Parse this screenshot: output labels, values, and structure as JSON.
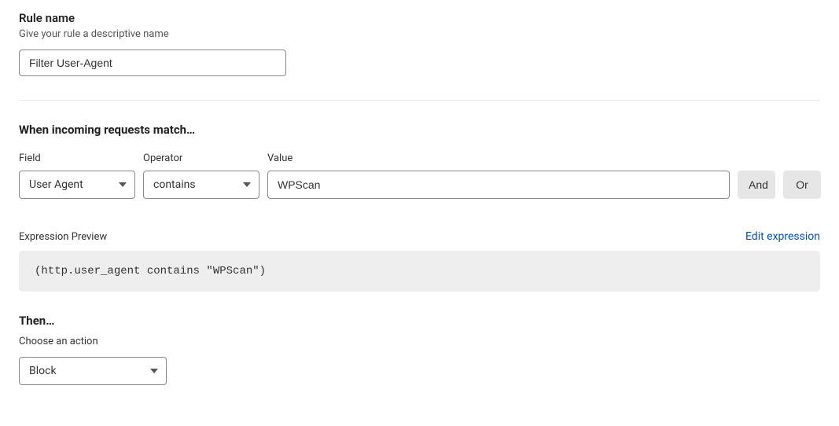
{
  "ruleName": {
    "title": "Rule name",
    "subtitle": "Give your rule a descriptive name",
    "value": "Filter User-Agent"
  },
  "match": {
    "heading": "When incoming requests match…",
    "labels": {
      "field": "Field",
      "operator": "Operator",
      "value": "Value"
    },
    "field": "User Agent",
    "operator": "contains",
    "value": "WPScan",
    "andBtn": "And",
    "orBtn": "Or"
  },
  "preview": {
    "label": "Expression Preview",
    "editLink": "Edit expression",
    "code": "(http.user_agent contains \"WPScan\")"
  },
  "then": {
    "heading": "Then…",
    "subtitle": "Choose an action",
    "action": "Block"
  }
}
